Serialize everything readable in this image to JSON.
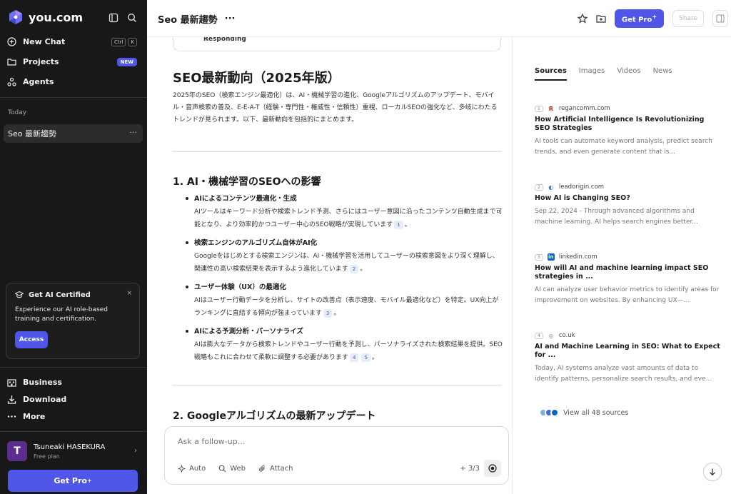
{
  "sidebar": {
    "logo_text": "you.com",
    "nav": [
      {
        "label": "New Chat",
        "icon": "plus-circle-icon",
        "shortcut": [
          "Ctrl",
          "K"
        ]
      },
      {
        "label": "Projects",
        "icon": "folder-icon",
        "badge": "NEW"
      },
      {
        "label": "Agents",
        "icon": "agents-icon"
      }
    ],
    "section_today": "Today",
    "chats": [
      {
        "title": "Seo 最新趨勢",
        "menu": "···"
      }
    ],
    "cert": {
      "title": "Get AI Certified",
      "close": "×",
      "description": "Experience our AI role-based training and certification.",
      "button": "Access"
    },
    "bottom_nav": [
      {
        "label": "Business",
        "icon": "business-icon"
      },
      {
        "label": "Download",
        "icon": "download-icon"
      },
      {
        "label": "More",
        "icon": "more-icon"
      }
    ],
    "user": {
      "initial": "T",
      "name": "Tsuneaki HASEKURA",
      "plan": "Free plan",
      "chevron": "›"
    },
    "get_pro": "Get Pro",
    "get_pro_sup": "+"
  },
  "header": {
    "title": "Seo 最新趨勢",
    "menu": "···",
    "get_pro": "Get Pro",
    "get_pro_sup": "+",
    "share": "Share"
  },
  "main": {
    "responding": "Responding",
    "h1": "SEO最新動向（2025年版）",
    "intro": "2025年のSEO（検索エンジン最適化）は、AI・機械学習の進化、Googleアルゴリズムのアップデート、モバイル・音声検索の普及、E-E-A-T（経験・専門性・権威性・信頼性）重視、ローカルSEOの強化など、多岐にわたるトレンドが見られます。以下、最新動向を包括的にまとめます。",
    "section1": "1. AI・機械学習のSEOへの影響",
    "bullets": [
      {
        "title": "AIによるコンテンツ最適化・生成",
        "text": "AIツールはキーワード分析や検索トレンド予測、さらにはユーザー意図に沿ったコンテンツ自動生成まで可能となり、より効率的かつユーザー中心のSEO戦略が実現しています",
        "cites": [
          "1"
        ],
        "end": "。"
      },
      {
        "title": "検索エンジンのアルゴリズム自体がAI化",
        "text": "Googleをはじめとする検索エンジンは、AI・機械学習を活用してユーザーの検索意図をより深く理解し、関連性の高い検索結果を表示するよう進化しています",
        "cites": [
          "2"
        ],
        "end": "。"
      },
      {
        "title": "ユーザー体験（UX）の最適化",
        "text": "AIはユーザー行動データを分析し、サイトの改善点（表示速度、モバイル最適化など）を特定。UX向上がランキングに直結する傾向が強まっています",
        "cites": [
          "3"
        ],
        "end": "。"
      },
      {
        "title": "AIによる予測分析・パーソナライズ",
        "text": "AIは膨大なデータから検索トレンドやユーザー行動を予測し、パーソナライズされた検索結果を提供。SEO戦略もこれに合わせて柔軟に調整する必要があります",
        "cites": [
          "4",
          "5"
        ],
        "end": "。"
      }
    ],
    "section2": "2. Googleアルゴリズムの最新アップデート"
  },
  "followup": {
    "placeholder": "Ask a follow-up...",
    "tools": [
      "Auto",
      "Web",
      "Attach"
    ],
    "count": "3/3"
  },
  "right": {
    "tabs": [
      "Sources",
      "Images",
      "Videos",
      "News"
    ],
    "sources": [
      {
        "num": "1",
        "domain": "regancomm.com",
        "favicon": "R",
        "fav_color": "#c0262d",
        "title": "How Artificial Intelligence Is Revolutionizing SEO Strategies",
        "snippet": "AI tools can automate keyword analysis, predict search trends, and even generate content that is..."
      },
      {
        "num": "2",
        "domain": "leadorigin.com",
        "favicon": "◐",
        "fav_color": "#3a6fd8",
        "title": "How AI is Changing SEO?",
        "snippet": "Sep 22, 2024 - Through advanced algorithms and machine learning. AI helps search engines better..."
      },
      {
        "num": "3",
        "domain": "linkedin.com",
        "favicon": "in",
        "fav_color": "#0a66c2",
        "title": "How will AI and machine learning impact SEO strategies in ...",
        "snippet": "AI can analyze user behavior metrics to identify areas for improvement on websites. By enhancing UX—..."
      },
      {
        "num": "4",
        "domain": "co.uk",
        "favicon": "◎",
        "fav_color": "#8a8a8a",
        "title": "AI and Machine Learning in SEO: What to Expect for ...",
        "snippet": "Today, AI systems analyze vast amounts of data to identify patterns, personalize search results, and eve..."
      }
    ],
    "view_all": "View all 48 sources",
    "colors": {
      "accent": "#4f56e8"
    }
  }
}
